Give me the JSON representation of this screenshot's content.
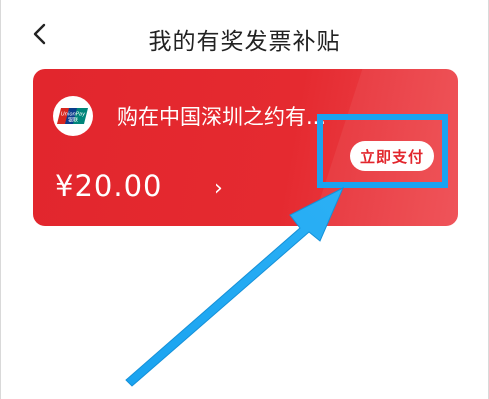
{
  "header": {
    "title": "我的有奖发票补贴"
  },
  "card": {
    "merchant_name": "购在中国深圳之约有...",
    "amount": "¥20.00",
    "amount_chevron": "›",
    "pay_button_label": "立即支付",
    "logo_text_top": "UnionPay",
    "logo_text_bottom": "银联"
  },
  "colors": {
    "card_red": "#e2262d",
    "highlight_blue": "#1aa3f0"
  }
}
